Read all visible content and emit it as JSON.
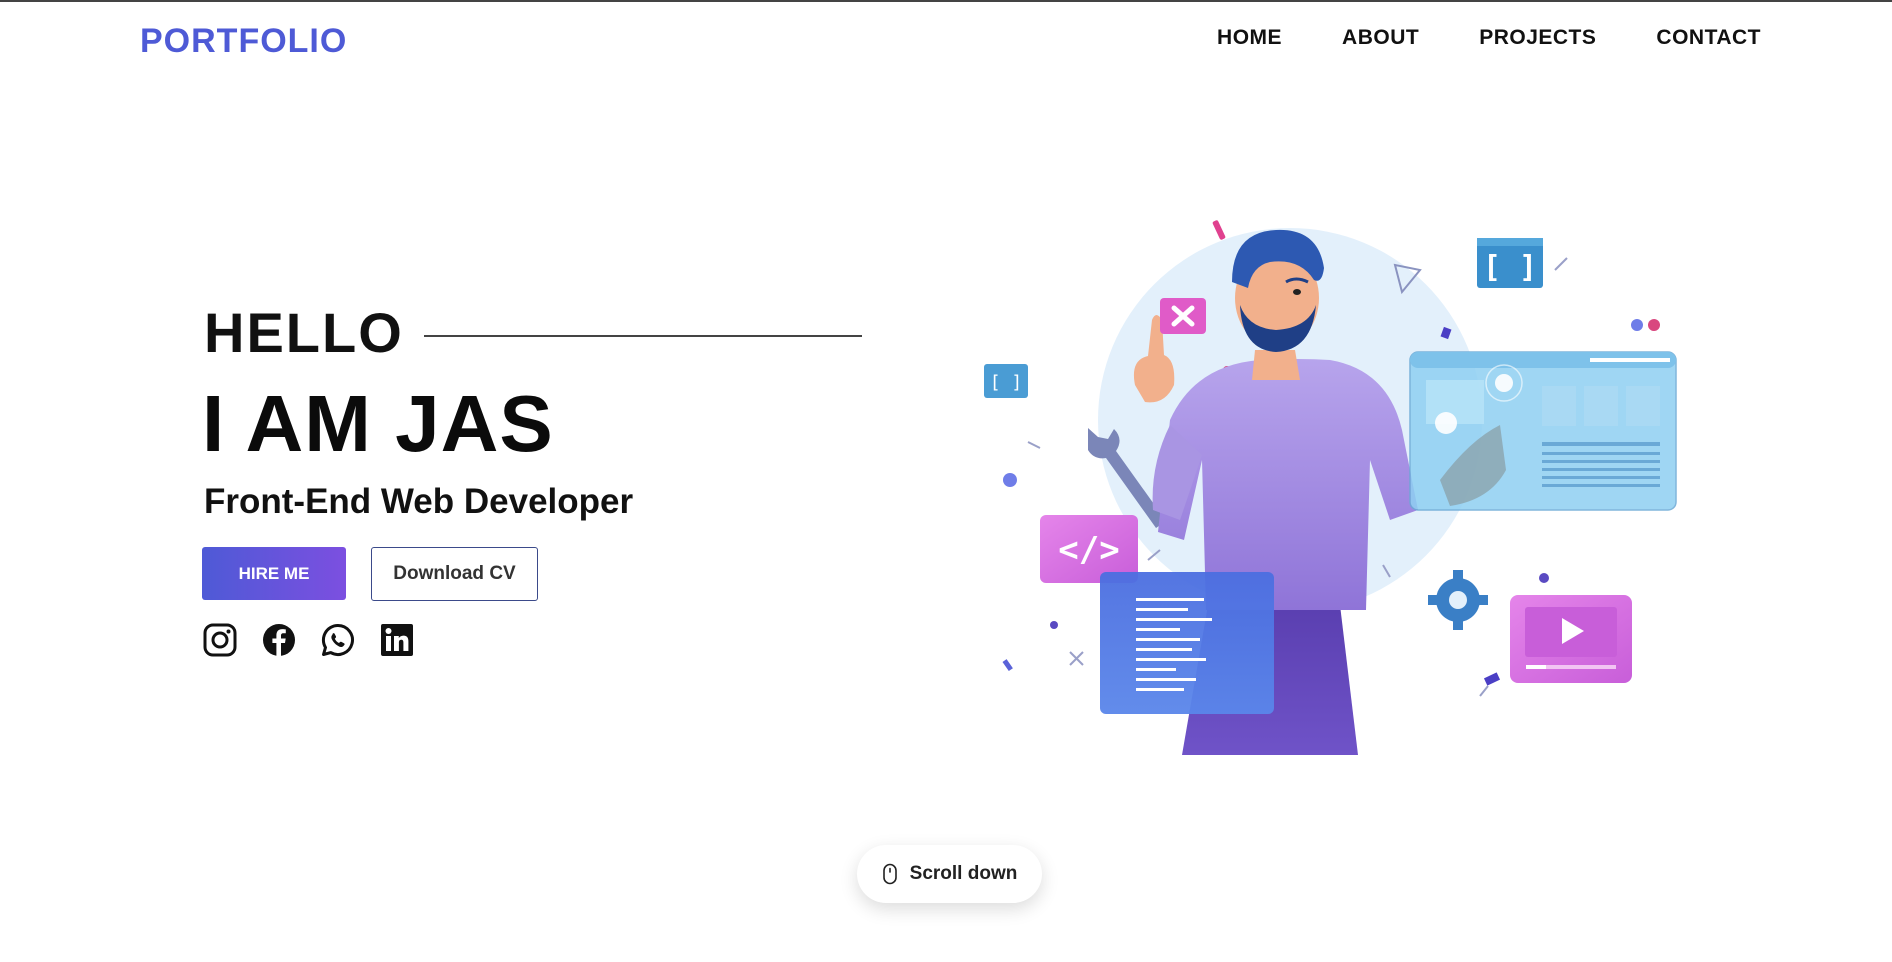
{
  "brand": {
    "logo": "PORTFOLIO",
    "accent": "#4e5ad6"
  },
  "nav": {
    "items": [
      "HOME",
      "ABOUT",
      "PROJECTS",
      "CONTACT"
    ]
  },
  "hero": {
    "greeting": "HELLO",
    "name": "I AM JAS",
    "role": "Front-End Web Developer",
    "hire_label": "HIRE ME",
    "cv_label": "Download CV",
    "socials": [
      "instagram-icon",
      "facebook-icon",
      "whatsapp-icon",
      "linkedin-icon"
    ]
  },
  "scroll": {
    "label": "Scroll down",
    "icon": "mouse-icon"
  }
}
